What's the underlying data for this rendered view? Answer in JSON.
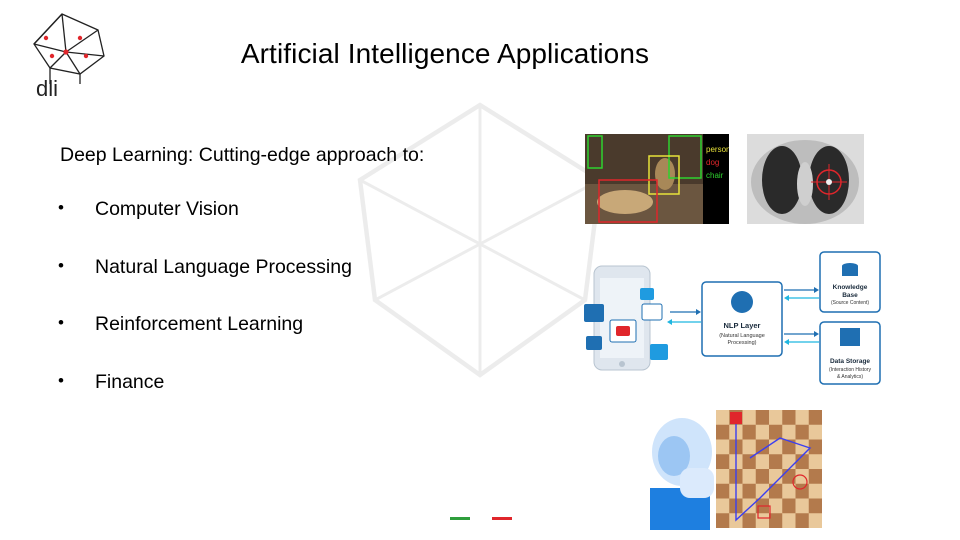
{
  "slide": {
    "title": "Artificial Intelligence Applications",
    "subtitle": "Deep Learning: Cutting-edge approach to:",
    "bullet_char": "•",
    "bullets": [
      "Computer Vision",
      "Natural Language Processing",
      "Reinforcement Learning",
      "Finance"
    ]
  },
  "logo": {
    "text": "dli"
  },
  "images": {
    "cv_labels": [
      "person",
      "dog",
      "chair"
    ],
    "nlp": {
      "center_title": "NLP Layer",
      "center_sub1": "(Natural Language",
      "center_sub2": "Processing)",
      "kb_title1": "Knowledge",
      "kb_title2": "Base",
      "kb_sub": "(Source Content)",
      "ds_title": "Data Storage",
      "ds_sub1": "(Interaction History",
      "ds_sub2": "& Analytics)"
    }
  },
  "colors": {
    "accent_green": "#2e9e3c",
    "accent_red": "#e0262b",
    "nlp_blue": "#1f6fb2"
  }
}
